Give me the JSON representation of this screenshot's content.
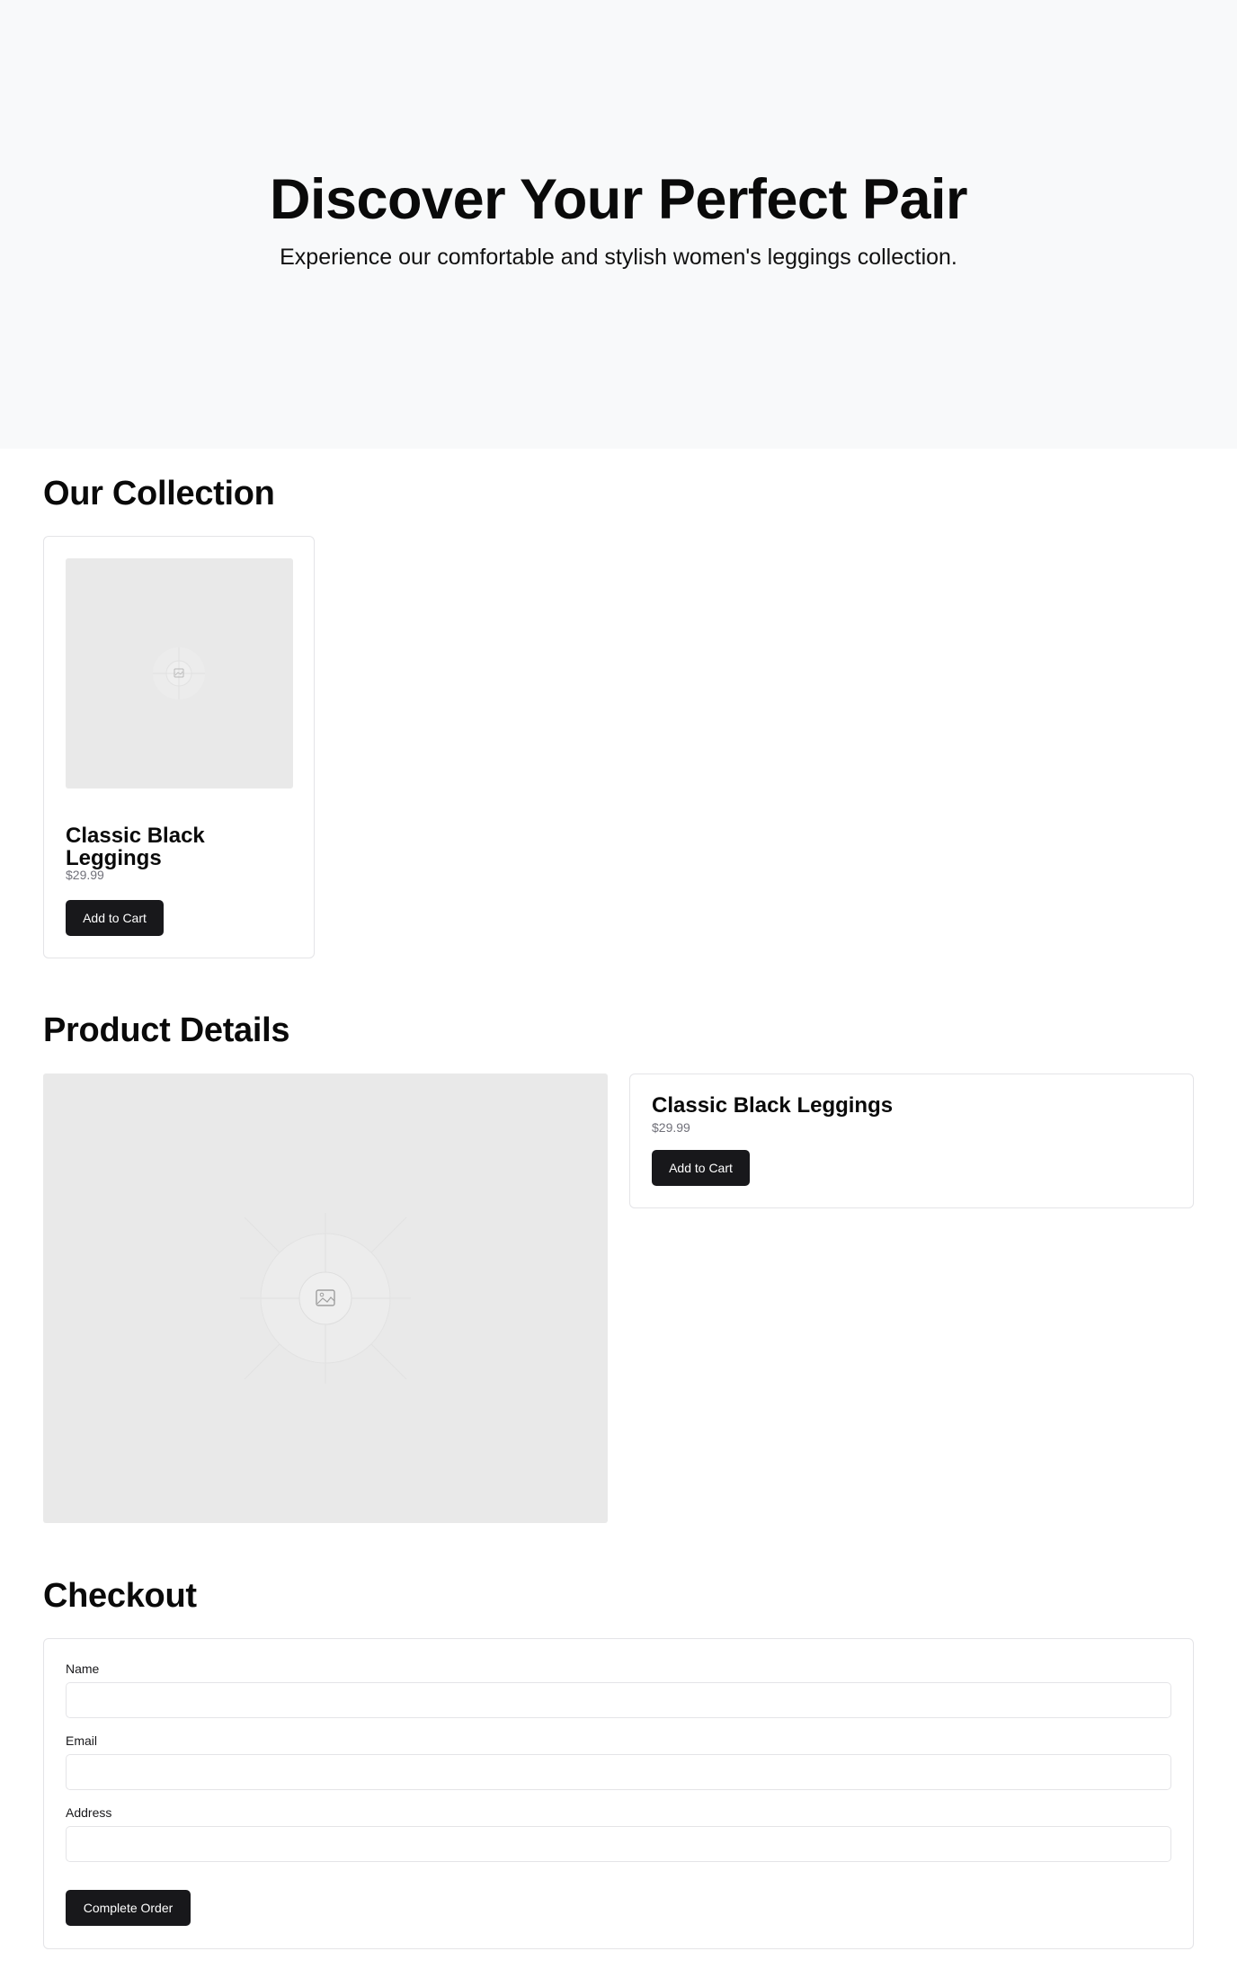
{
  "hero": {
    "title": "Discover Your Perfect Pair",
    "subtitle": "Experience our comfortable and stylish women's leggings collection."
  },
  "collection": {
    "heading": "Our Collection",
    "products": [
      {
        "name": "Classic Black Leggings",
        "price": "$29.99",
        "button_label": "Add to Cart",
        "image_icon": "image-placeholder-icon"
      }
    ]
  },
  "details": {
    "heading": "Product Details",
    "name": "Classic Black Leggings",
    "price": "$29.99",
    "button_label": "Add to Cart",
    "image_icon": "image-placeholder-icon"
  },
  "checkout": {
    "heading": "Checkout",
    "fields": [
      {
        "label": "Name",
        "value": "",
        "placeholder": ""
      },
      {
        "label": "Email",
        "value": "",
        "placeholder": ""
      },
      {
        "label": "Address",
        "value": "",
        "placeholder": ""
      }
    ],
    "submit_label": "Complete Order"
  },
  "colors": {
    "hero_bg": "#f8f9fa",
    "button_bg": "#18181b",
    "border": "#e4e4e7",
    "placeholder_bg": "#e9e9e9"
  }
}
